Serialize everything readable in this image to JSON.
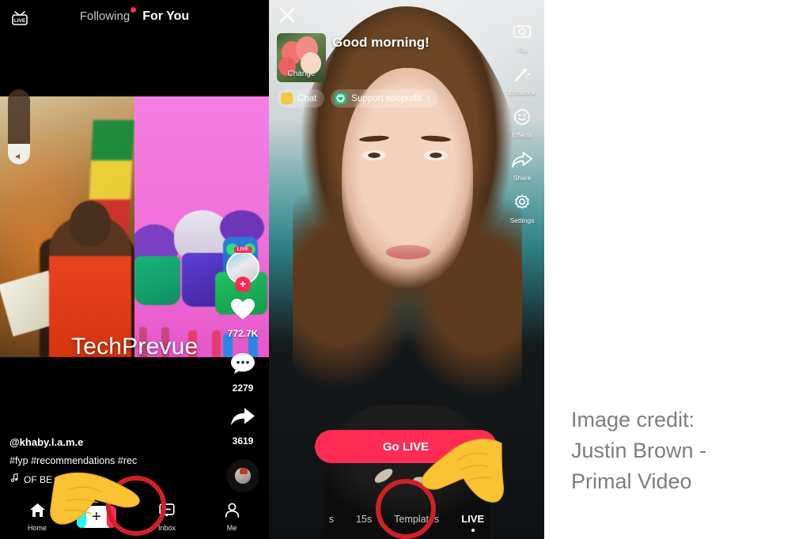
{
  "feed": {
    "top": {
      "live_icon": "live-tv-icon",
      "tabs": [
        {
          "label": "Following",
          "active": false,
          "has_dot": true
        },
        {
          "label": "For You",
          "active": true,
          "has_dot": false
        }
      ]
    },
    "watermark": "TechPrevue",
    "caption": {
      "username": "@khaby.l.a.m.e",
      "hashtags": "#fyp #recommendations #rec",
      "music": "OF BE ... ntains mv",
      "music_icon": "music-note-icon"
    },
    "rail": {
      "avatar_badge": "LIVE",
      "follow_label": "+",
      "items": [
        {
          "icon": "heart-icon",
          "count": "772.7K"
        },
        {
          "icon": "comment-icon",
          "count": "2279"
        },
        {
          "icon": "share-arrow-icon",
          "count": "3619"
        }
      ],
      "disc_icon": "music-disc-icon"
    },
    "volume": {
      "icon": "speaker-icon",
      "level_percent": 27
    },
    "bottom_nav": [
      {
        "label": "Home",
        "icon": "home-icon",
        "active": true
      },
      {
        "label": "",
        "icon": "create-plus-icon",
        "active": false
      },
      {
        "label": "Inbox",
        "icon": "inbox-icon",
        "active": false
      },
      {
        "label": "Me",
        "icon": "person-icon",
        "active": false
      }
    ]
  },
  "live_setup": {
    "close_icon": "close-x-icon",
    "thumbnail": {
      "change_label": "Change",
      "alt": "balloons-thumbnail"
    },
    "title": "Good morning!",
    "chips": [
      {
        "label": "Chat",
        "icon": "chat-bubble-icon",
        "chevron": ""
      },
      {
        "label": "Support nonprofit",
        "icon": "nonprofit-heart-icon",
        "chevron": "›"
      }
    ],
    "rail": [
      {
        "label": "Flip",
        "icon": "camera-flip-icon"
      },
      {
        "label": "Enhance",
        "icon": "magic-wand-icon"
      },
      {
        "label": "Effects",
        "icon": "smiley-effects-icon"
      },
      {
        "label": "Share",
        "icon": "share-arrow-icon"
      },
      {
        "label": "Settings",
        "icon": "gear-icon"
      }
    ],
    "go_live_label": "Go LIVE",
    "modes": [
      {
        "label": "s",
        "active": false
      },
      {
        "label": "15s",
        "active": false
      },
      {
        "label": "Templates",
        "active": false
      },
      {
        "label": "LIVE",
        "active": true
      }
    ]
  },
  "annotations": {
    "pointer_icon": "pointing-hand-icon",
    "highlight_color": "#cf2027",
    "targets": [
      "create-plus-icon",
      "live-mode-tab"
    ]
  },
  "credit": {
    "line1": "Image credit:",
    "line2": "Justin Brown -",
    "line3": "Primal Video"
  },
  "colors": {
    "brand_red": "#fe2c55",
    "brand_cyan": "#25f4ee",
    "annotation_red": "#cf2027",
    "credit_gray": "#7d7d7d"
  }
}
